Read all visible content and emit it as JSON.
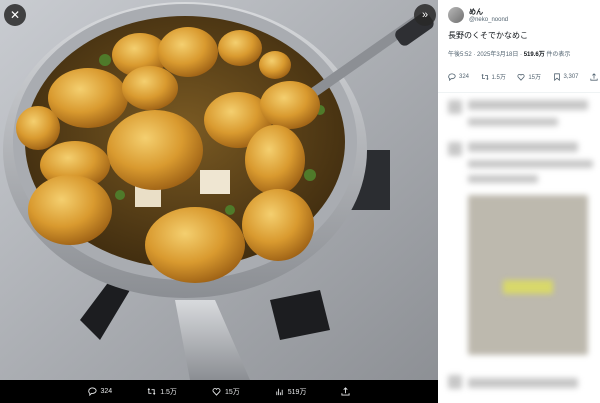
{
  "viewer": {
    "close_icon": "close-icon",
    "expand_icon": "expand-icon",
    "image_alt": "Mushroom miso soup in a metal pot on a stove",
    "actions": [
      {
        "icon": "reply-icon",
        "value": "324"
      },
      {
        "icon": "retweet-icon",
        "value": "1.5万"
      },
      {
        "icon": "like-icon",
        "value": "15万"
      },
      {
        "icon": "views-icon",
        "value": "519万"
      },
      {
        "icon": "share-icon",
        "value": ""
      }
    ]
  },
  "post": {
    "display_name": "めん",
    "handle": "@neko_noond",
    "text": "長野のくそでかなめこ",
    "time": "午後5:52 · 2025年3月18日 · ",
    "views_value": "519.6万",
    "views_suffix": " 件の表示",
    "stats": [
      {
        "icon": "reply-icon",
        "value": "324"
      },
      {
        "icon": "retweet-icon",
        "value": "1.5万"
      },
      {
        "icon": "like-icon",
        "value": "15万"
      },
      {
        "icon": "bookmark-icon",
        "value": "3,307"
      },
      {
        "icon": "share-icon",
        "value": ""
      }
    ]
  },
  "colors": {
    "viewer_bg": "#000000",
    "panel_bg": "#ffffff",
    "text_secondary": "#536471"
  }
}
